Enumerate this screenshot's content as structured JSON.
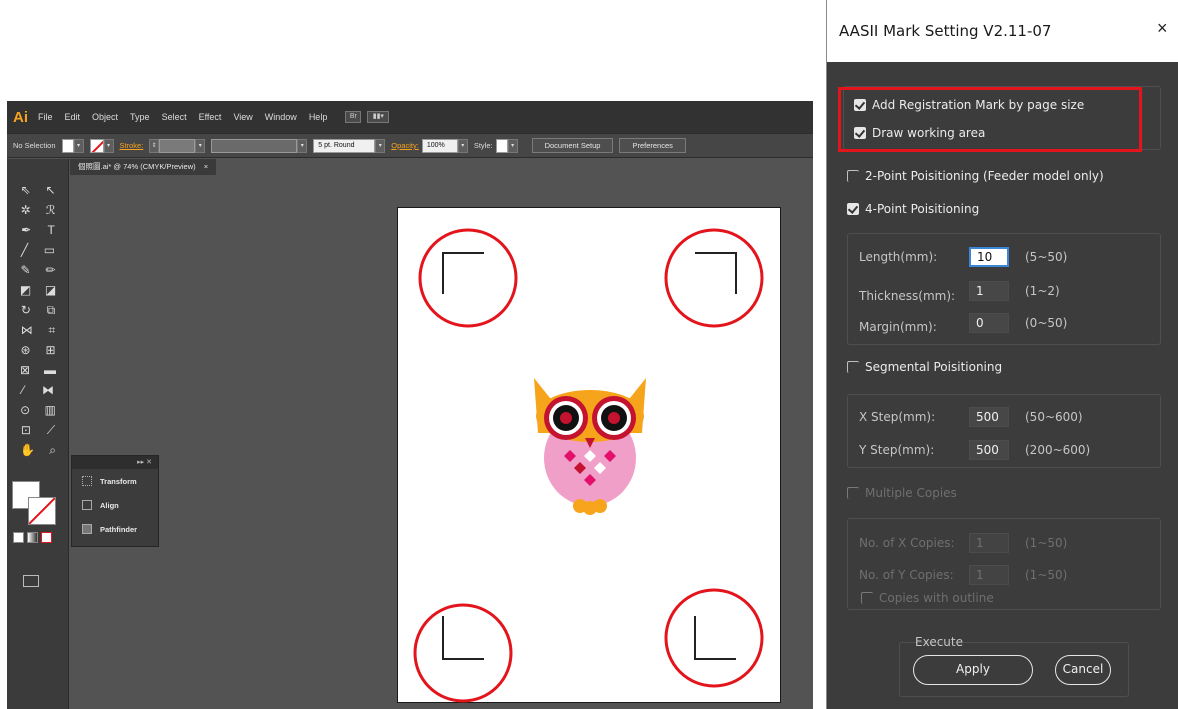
{
  "illustrator": {
    "logo": "Ai",
    "menu": [
      "File",
      "Edit",
      "Object",
      "Type",
      "Select",
      "Effect",
      "View",
      "Window",
      "Help"
    ],
    "bridge_btn": "Br",
    "control": {
      "selection": "No Selection",
      "stroke_label": "Stroke:",
      "brush": "5 pt. Round",
      "opacity_label": "Opacity:",
      "opacity_value": "100%",
      "style_label": "Style:",
      "document_setup": "Document Setup",
      "preferences": "Preferences"
    },
    "doc_tab": "個照圖.ai* @ 74% (CMYK/Preview)",
    "doc_tab_close": "×",
    "panel": {
      "items": [
        "Transform",
        "Align",
        "Pathfinder"
      ]
    }
  },
  "dialog": {
    "title": "AASII Mark Setting V2.11-07",
    "close": "×",
    "add_reg_mark": {
      "label": "Add Registration Mark by page size",
      "checked": true
    },
    "draw_working_area": {
      "label": "Draw working area",
      "checked": true
    },
    "two_point": {
      "label": "2-Point Poisitioning (Feeder model only)",
      "checked": false
    },
    "four_point": {
      "label": "4-Point Poisitioning",
      "checked": true
    },
    "length": {
      "label": "Length(mm):",
      "value": "10",
      "range": "(5~50)"
    },
    "thickness": {
      "label": "Thickness(mm):",
      "value": "1",
      "range": "(1~2)"
    },
    "margin": {
      "label": "Margin(mm):",
      "value": "0",
      "range": "(0~50)"
    },
    "segmental": {
      "label": "Segmental Poisitioning",
      "checked": false
    },
    "x_step": {
      "label": "X Step(mm):",
      "value": "500",
      "range": "(50~600)"
    },
    "y_step": {
      "label": "Y Step(mm):",
      "value": "500",
      "range": "(200~600)"
    },
    "multiple": {
      "label": "Multiple Copies",
      "checked": false
    },
    "x_copies": {
      "label": "No. of X Copies:",
      "value": "1",
      "range": "(1~50)"
    },
    "y_copies": {
      "label": "No. of Y Copies:",
      "value": "1",
      "range": "(1~50)"
    },
    "outline": {
      "label": "Copies with outline",
      "checked": false
    },
    "execute_label": "Execute",
    "apply": "Apply",
    "cancel": "Cancel"
  },
  "colors": {
    "highlight_red": "#e3141b",
    "owl_orange": "#f7a41d",
    "owl_pink": "#f0a0c8"
  }
}
